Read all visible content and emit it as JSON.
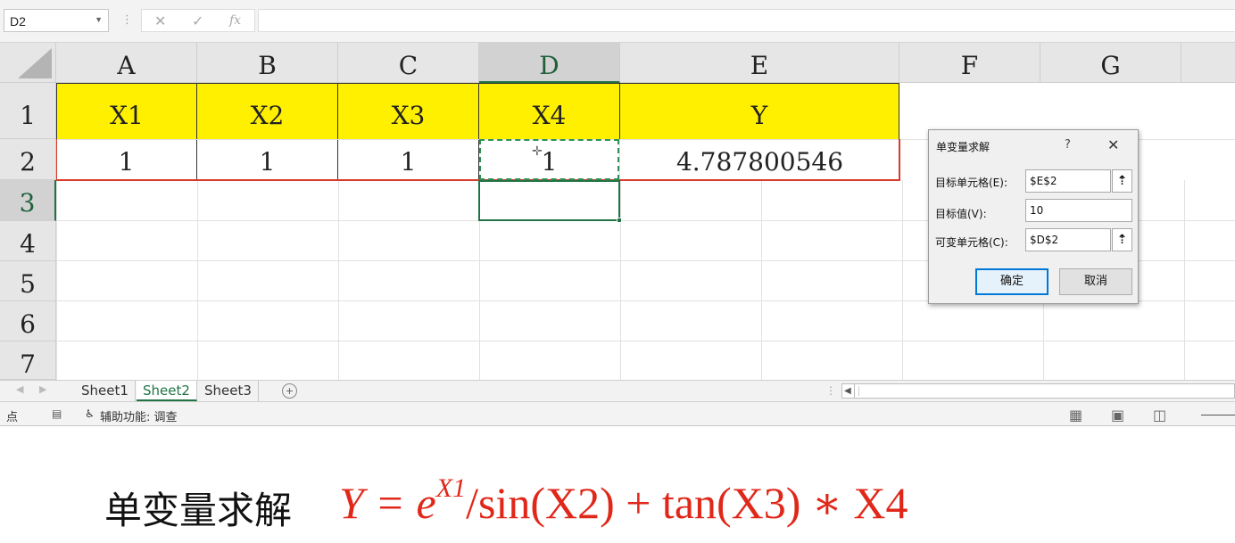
{
  "formula_bar": {
    "name_box": "D2",
    "cancel_icon": "✕",
    "enter_icon": "✓",
    "fx_label": "fx",
    "formula": ""
  },
  "columns": [
    "A",
    "B",
    "C",
    "D",
    "E",
    "F",
    "G"
  ],
  "rows": [
    "1",
    "2",
    "3",
    "4",
    "5",
    "6",
    "7"
  ],
  "selected_column": "D",
  "selected_row": "3",
  "cells": {
    "A1": "X1",
    "B1": "X2",
    "C1": "X3",
    "D1": "X4",
    "E1": "Y",
    "A2": "1",
    "B2": "1",
    "C2": "1",
    "D2": "1",
    "E2": "4.787800546"
  },
  "colors": {
    "header_fill": "#fff000",
    "accent_green": "#217346",
    "table_outline_red": "#d93b2b",
    "formula_red": "#e0281a"
  },
  "dialog": {
    "title": "单变量求解",
    "help": "?",
    "close": "✕",
    "target_cell_label": "目标单元格(E):",
    "target_cell_value": "$E$2",
    "target_value_label": "目标值(V):",
    "target_value": "10",
    "changing_cell_label": "可变单元格(C):",
    "changing_cell_value": "$D$2",
    "ok_label": "确定",
    "cancel_label": "取消"
  },
  "sheet_tabs": [
    {
      "label": "Sheet1",
      "active": false
    },
    {
      "label": "Sheet2",
      "active": true
    },
    {
      "label": "Sheet3",
      "active": false
    }
  ],
  "status_bar": {
    "mode": "点",
    "accessibility": "辅助功能: 调查"
  },
  "caption": {
    "label": "单变量求解",
    "formula_main_pre": "Y = e",
    "formula_sup": "X1",
    "formula_main_post": "/sin(X2) + tan(X3) ∗ X4"
  }
}
